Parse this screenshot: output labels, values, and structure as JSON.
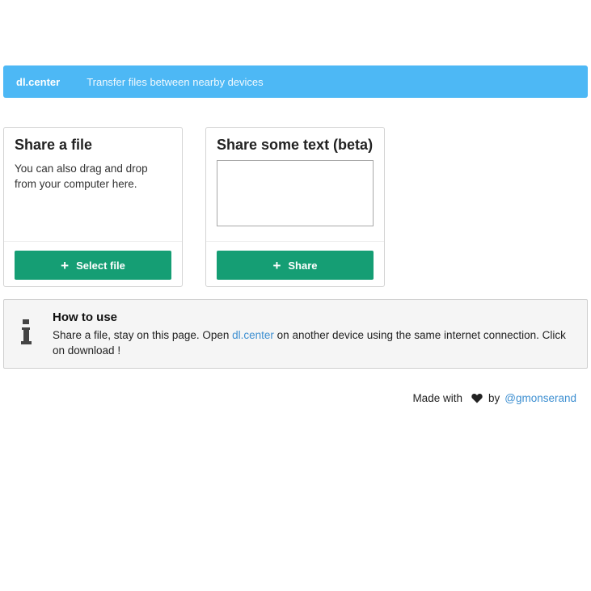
{
  "navbar": {
    "brand": "dl.center",
    "tagline": "Transfer files between nearby devices",
    "color": "#4db8f5"
  },
  "share_file": {
    "title": "Share a file",
    "description": "You can also drag and drop from your computer here.",
    "button_label": "Select file",
    "button_icon": "plus-icon"
  },
  "share_text": {
    "title": "Share some text (beta)",
    "textarea_value": "",
    "button_label": "Share",
    "button_icon": "plus-icon"
  },
  "how_to": {
    "icon": "info-icon",
    "title": "How to use",
    "text_before": "Share a file, stay on this page. Open ",
    "link": "dl.center",
    "text_after": " on another device using the same internet connection. Click on download !"
  },
  "footer": {
    "made_with": "Made with",
    "heart_icon": "heart-icon",
    "by": "by",
    "author": "@gmonserand"
  },
  "colors": {
    "accent_button": "#159e74",
    "link": "#3d8fd1"
  }
}
